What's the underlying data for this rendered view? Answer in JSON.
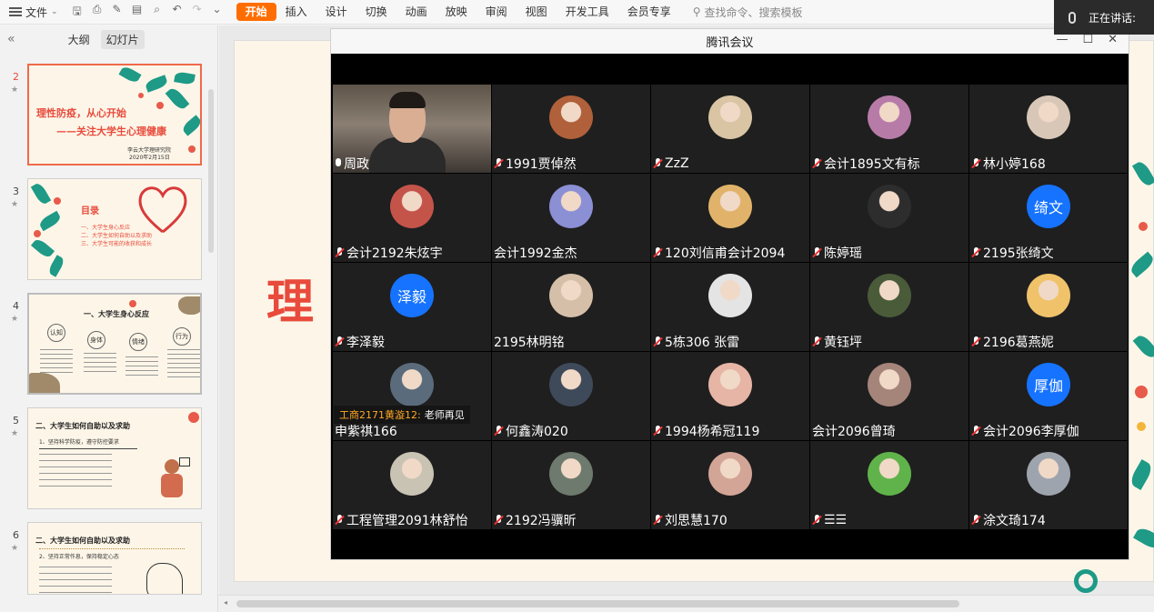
{
  "toolbar": {
    "file_label": "文件",
    "tabs": [
      "开始",
      "插入",
      "设计",
      "切换",
      "动画",
      "放映",
      "审阅",
      "视图",
      "开发工具",
      "会员专享"
    ],
    "search_placeholder": "查找命令、搜索模板"
  },
  "speaking": {
    "label": "正在讲话:"
  },
  "left_panel": {
    "tab_outline": "大纲",
    "tab_slides": "幻灯片",
    "slides": [
      {
        "num": "2",
        "title_line1": "理性防疫，从心开始",
        "title_line2": "——关注大学生心理健康",
        "footer1": "李云大学理研究院",
        "footer2": "2020年2月15日"
      },
      {
        "num": "3",
        "title": "目录",
        "items": [
          "一、大学生身心反应",
          "二、大学生如何自助以及求助",
          "三、大学生可能的收获和成长"
        ]
      },
      {
        "num": "4",
        "title": "一、大学生身心反应",
        "labels": [
          "认知",
          "身体",
          "情绪",
          "行为"
        ]
      },
      {
        "num": "5",
        "title": "二、大学生如何自助以及求助",
        "sub": "1、坚持科学防疫，遵守防控要求"
      },
      {
        "num": "6",
        "title": "二、大学生如何自助以及求助",
        "sub": "2、坚持正常作息，保持稳定心态"
      }
    ]
  },
  "main_slide": {
    "big_text": "理"
  },
  "meeting": {
    "title": "腾讯会议",
    "controls": {
      "minimize": "—",
      "maximize": "☐",
      "close": "✕"
    },
    "chat": {
      "who": "工商2171黄漩12:",
      "msg": "老师再见"
    },
    "participants": [
      {
        "name": "周政",
        "mic": "on",
        "type": "video"
      },
      {
        "name": "1991贾倬然",
        "mic": "off",
        "type": "img",
        "color": "#b0603a"
      },
      {
        "name": "ZzZ",
        "mic": "off",
        "type": "img",
        "color": "#d9c4a4"
      },
      {
        "name": "会计1895文有标",
        "mic": "off",
        "type": "img",
        "color": "#b77ba8"
      },
      {
        "name": "林小婷168",
        "mic": "off",
        "type": "img",
        "color": "#d8c7b7"
      },
      {
        "name": "会计2192朱炫宇",
        "mic": "off",
        "type": "img",
        "color": "#c4544a"
      },
      {
        "name": "会计1992金杰",
        "mic": "none",
        "type": "img",
        "color": "#8b8fd4"
      },
      {
        "name": "120刘信甫会计2094",
        "mic": "off",
        "type": "img",
        "color": "#e1b36a"
      },
      {
        "name": "陈婷瑶",
        "mic": "off",
        "type": "img",
        "color": "#2d2d2d"
      },
      {
        "name": "2195张绮文",
        "mic": "off",
        "type": "text",
        "avatar_text": "绮文"
      },
      {
        "name": "李泽毅",
        "mic": "off",
        "type": "text",
        "avatar_text": "泽毅"
      },
      {
        "name": "2195林明铭",
        "mic": "none",
        "type": "img",
        "color": "#d6bfa9"
      },
      {
        "name": "5栋306 张雷",
        "mic": "off",
        "type": "img",
        "color": "#e4e4e4"
      },
      {
        "name": "黄钰坪",
        "mic": "off",
        "type": "img",
        "color": "#4a5b3a"
      },
      {
        "name": "2196葛燕妮",
        "mic": "off",
        "type": "img",
        "color": "#f0c26a"
      },
      {
        "name": "申紫祺166",
        "mic": "none",
        "type": "img",
        "color": "#5a6b7c"
      },
      {
        "name": "何鑫涛020",
        "mic": "off",
        "type": "img",
        "color": "#3e4a5a"
      },
      {
        "name": "1994杨希冠119",
        "mic": "off",
        "type": "img",
        "color": "#e6b5a5"
      },
      {
        "name": "会计2096曾琦",
        "mic": "none",
        "type": "img",
        "color": "#a5847a"
      },
      {
        "name": "会计2096李厚伽",
        "mic": "off",
        "type": "text",
        "avatar_text": "厚伽"
      },
      {
        "name": "工程管理2091林舒怡",
        "mic": "off",
        "type": "img",
        "color": "#c9c3b4"
      },
      {
        "name": "2192冯骥昕",
        "mic": "off",
        "type": "img",
        "color": "#6d7a6d"
      },
      {
        "name": "刘思慧170",
        "mic": "off",
        "type": "img",
        "color": "#d3a596"
      },
      {
        "name": "☰☰",
        "mic": "off",
        "type": "img",
        "color": "#5fb34a"
      },
      {
        "name": "涂文琦174",
        "mic": "off",
        "type": "img",
        "color": "#9da4ad"
      }
    ]
  },
  "colors": {
    "accent": "#ff6d00",
    "meeting_avatar_blue": "#1673ff",
    "slide_red": "#e84b3c",
    "leaf_teal": "#1e9a87"
  }
}
